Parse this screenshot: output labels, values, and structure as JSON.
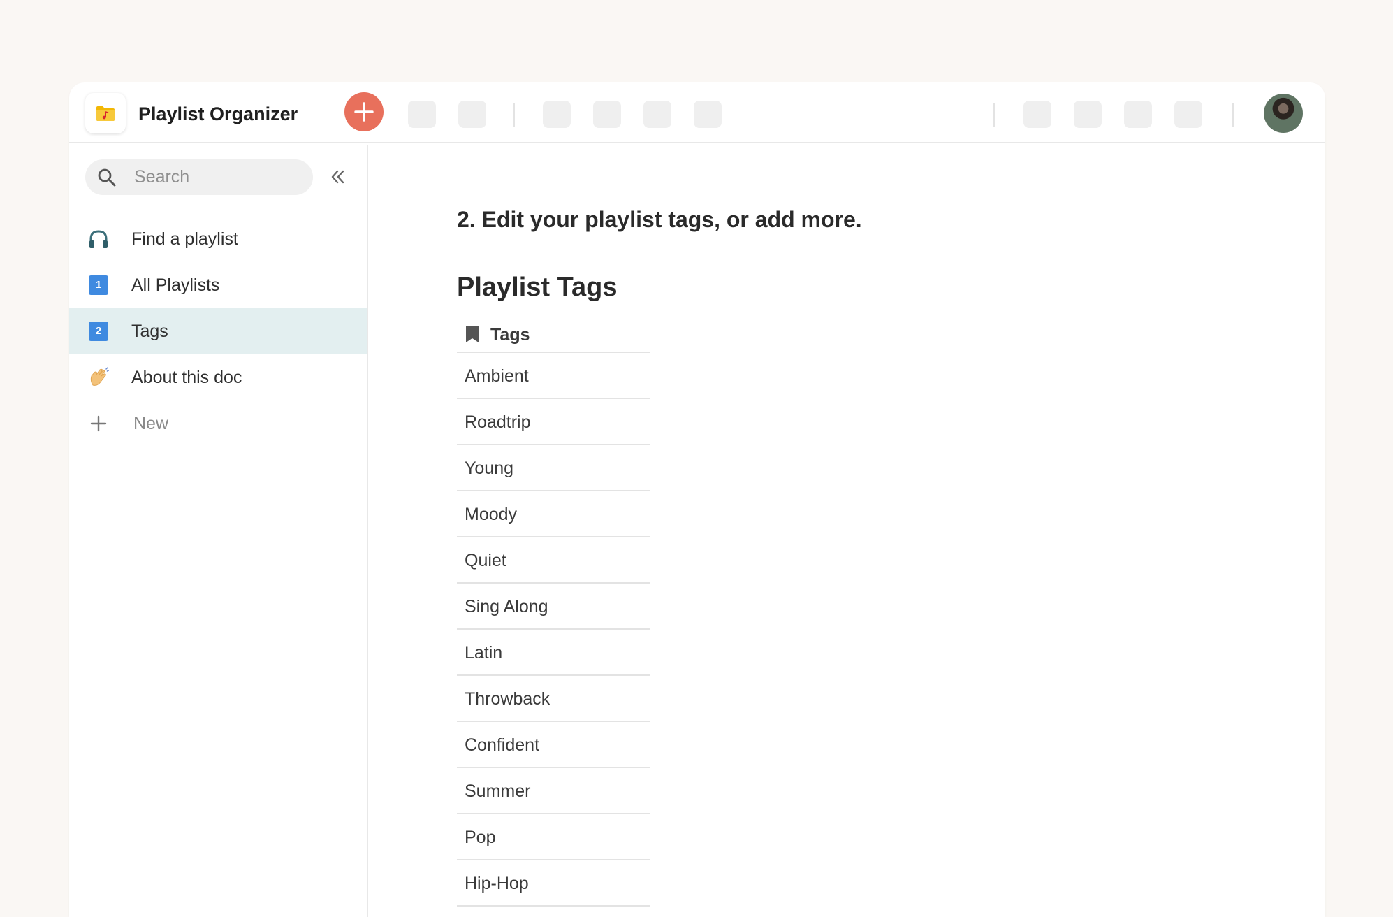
{
  "app": {
    "title": "Playlist Organizer",
    "accent_color": "#e8705c",
    "icon": "music-folder-icon"
  },
  "toolbar": {
    "add_icon": "plus-icon",
    "avatar_icon": "user-avatar"
  },
  "sidebar": {
    "search_placeholder": "Search",
    "collapse_icon": "double-chevron-left-icon",
    "items": [
      {
        "label": "Find a playlist",
        "icon": "headphones-icon"
      },
      {
        "label": "All Playlists",
        "icon": "number-1-badge",
        "badge": "1"
      },
      {
        "label": "Tags",
        "icon": "number-2-badge",
        "badge": "2",
        "active": true
      },
      {
        "label": "About this doc",
        "icon": "waving-hand-icon"
      }
    ],
    "new_label": "New"
  },
  "main": {
    "intro": "2. Edit your playlist tags, or add more.",
    "section_title": "Playlist Tags",
    "table": {
      "header": "Tags",
      "header_icon": "bookmark-icon",
      "rows": [
        "Ambient",
        "Roadtrip",
        "Young",
        "Moody",
        "Quiet",
        "Sing Along",
        "Latin",
        "Throwback",
        "Confident",
        "Summer",
        "Pop",
        "Hip-Hop"
      ]
    }
  }
}
